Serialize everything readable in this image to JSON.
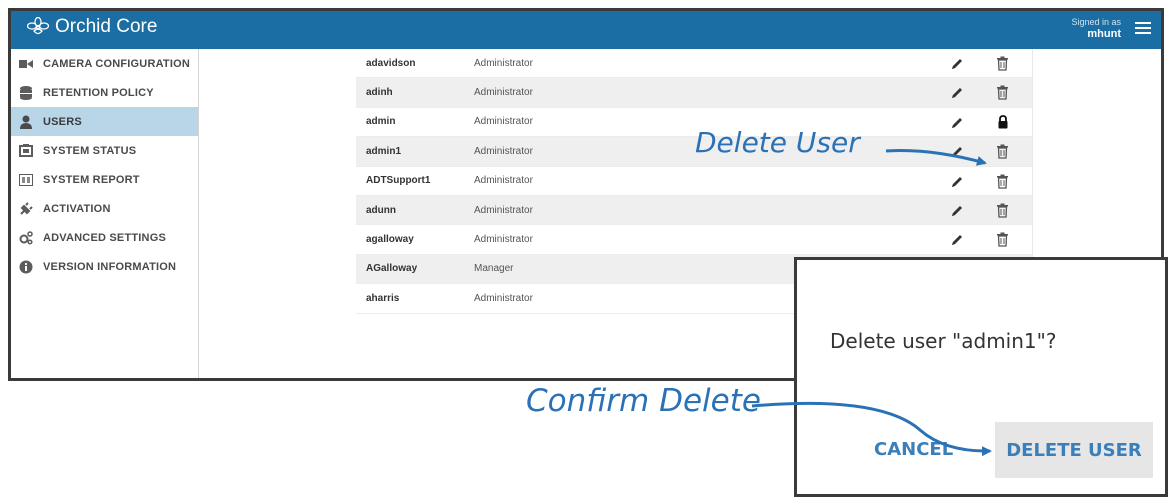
{
  "header": {
    "brand": "Orchid Core",
    "signed_in_label": "Signed in as",
    "username": "mhunt"
  },
  "sidebar": {
    "items": [
      {
        "label": "CAMERA CONFIGURATION",
        "icon": "video-camera-icon",
        "active": false
      },
      {
        "label": "RETENTION POLICY",
        "icon": "database-icon",
        "active": false
      },
      {
        "label": "USERS",
        "icon": "user-icon",
        "active": true
      },
      {
        "label": "SYSTEM STATUS",
        "icon": "status-monitor-icon",
        "active": false
      },
      {
        "label": "SYSTEM REPORT",
        "icon": "report-icon",
        "active": false
      },
      {
        "label": "ACTIVATION",
        "icon": "plug-icon",
        "active": false
      },
      {
        "label": "ADVANCED SETTINGS",
        "icon": "gears-icon",
        "active": false
      },
      {
        "label": "VERSION INFORMATION",
        "icon": "info-icon",
        "active": false
      }
    ]
  },
  "users": {
    "rows": [
      {
        "name": "adavidson",
        "role": "Administrator",
        "locked": false
      },
      {
        "name": "adinh",
        "role": "Administrator",
        "locked": false
      },
      {
        "name": "admin",
        "role": "Administrator",
        "locked": true
      },
      {
        "name": "admin1",
        "role": "Administrator",
        "locked": false
      },
      {
        "name": "ADTSupport1",
        "role": "Administrator",
        "locked": false
      },
      {
        "name": "adunn",
        "role": "Administrator",
        "locked": false
      },
      {
        "name": "agalloway",
        "role": "Administrator",
        "locked": false
      },
      {
        "name": "AGalloway",
        "role": "Manager",
        "locked": false
      },
      {
        "name": "aharris",
        "role": "Administrator",
        "locked": false
      }
    ]
  },
  "annotations": {
    "delete_user": "Delete User",
    "confirm_delete": "Confirm Delete",
    "color": "#2a72b5"
  },
  "dialog": {
    "message": "Delete user \"admin1\"?",
    "cancel_label": "CANCEL",
    "confirm_label": "DELETE USER"
  },
  "colors": {
    "header": "#1a6ea3",
    "active_nav": "#b9d6e8",
    "button_text": "#3b7fba"
  }
}
